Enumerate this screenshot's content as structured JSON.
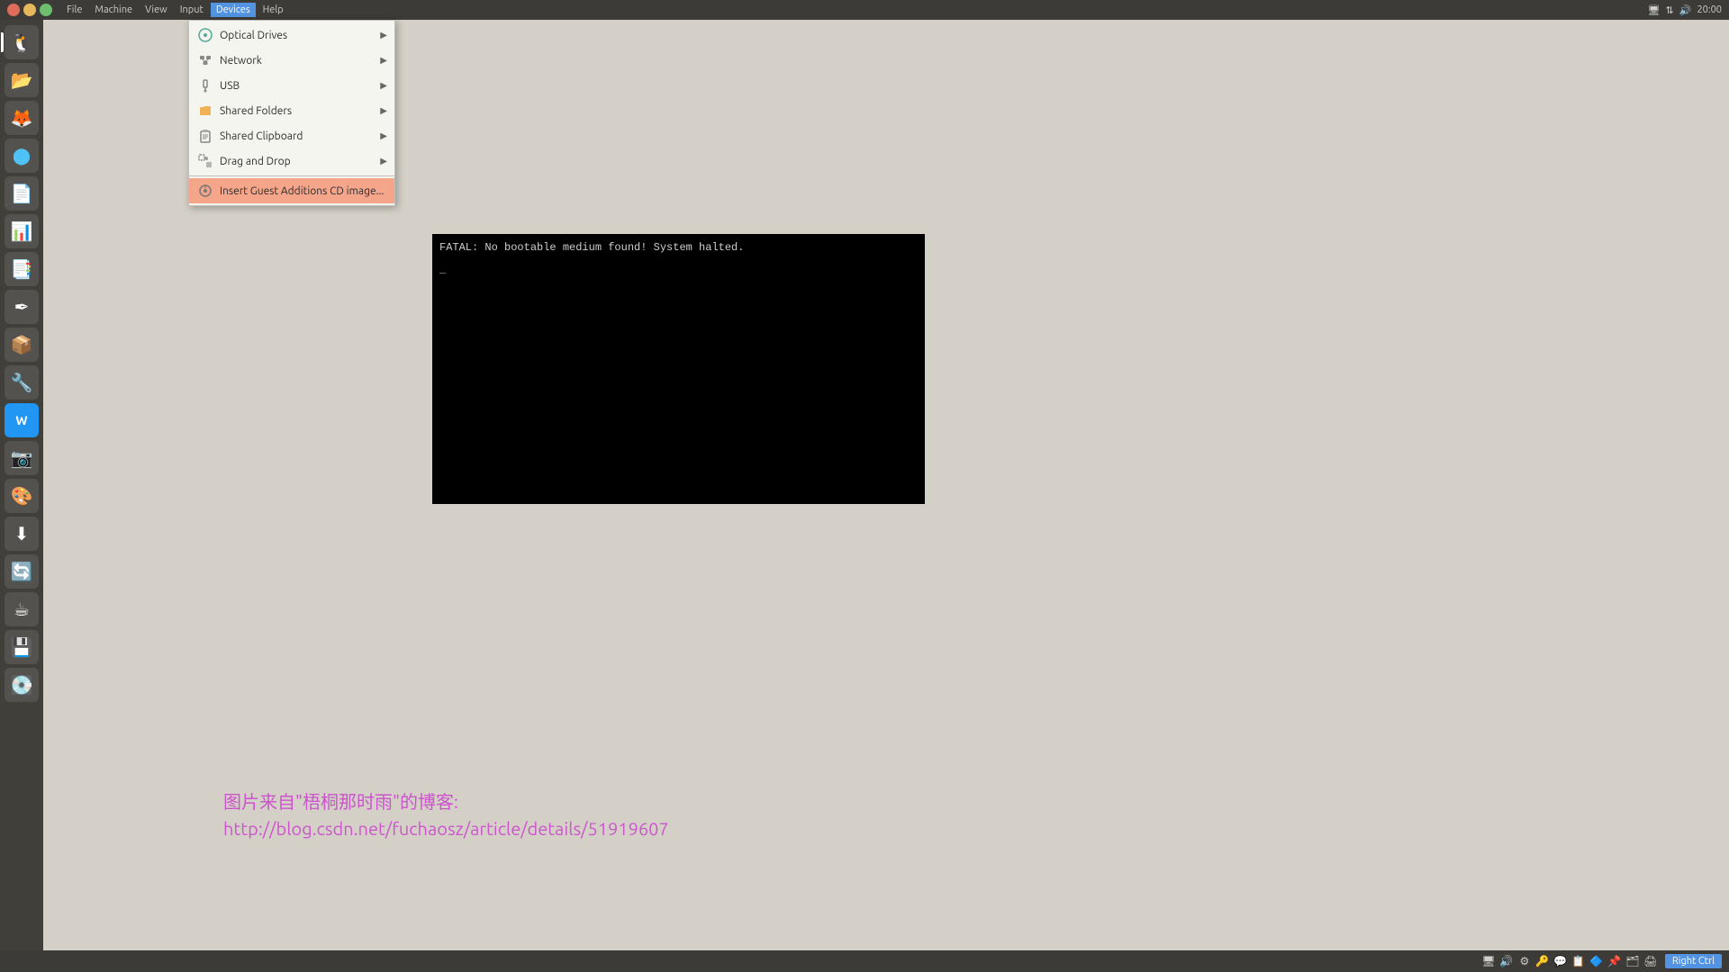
{
  "menubar": {
    "path": "|File|  Machine|  View|  Input|  Devices|",
    "path_items": [
      "File",
      "Machine",
      "View",
      "Input",
      "Devices",
      "Help"
    ],
    "active_item": "Devices",
    "time": "20:00",
    "win_title": "|File|  Machine|  View|  Input|  Devices|"
  },
  "dropdown": {
    "items": [
      {
        "id": "optical-drives",
        "label": "Optical Drives",
        "has_arrow": true,
        "icon": "💿"
      },
      {
        "id": "network",
        "label": "Network",
        "has_arrow": true,
        "icon": "🌐"
      },
      {
        "id": "usb",
        "label": "USB",
        "has_arrow": true,
        "icon": "🔌"
      },
      {
        "id": "shared-folders",
        "label": "Shared Folders",
        "has_arrow": true,
        "icon": "📁"
      },
      {
        "id": "shared-clipboard",
        "label": "Shared Clipboard",
        "has_arrow": true,
        "icon": "📋"
      },
      {
        "id": "drag-and-drop",
        "label": "Drag and Drop",
        "has_arrow": true,
        "icon": "🔀"
      },
      {
        "id": "insert-guest",
        "label": "Insert Guest Additions CD image...",
        "has_arrow": false,
        "icon": "💿",
        "highlighted": true
      }
    ]
  },
  "vm": {
    "screen_text": "FATAL: No bootable medium found! System halted.",
    "cursor": "_"
  },
  "attribution": {
    "line1": "图片来自\"梧桐那时雨\"的博客:",
    "line2": "http://blog.csdn.net/fuchaosz/article/details/51919607"
  },
  "taskbar": {
    "right_ctrl_label": "Right Ctrl",
    "time": "20:00"
  },
  "sidebar": {
    "apps": [
      {
        "id": "ubuntu",
        "icon": "🐧",
        "active": true
      },
      {
        "id": "files",
        "icon": "📂"
      },
      {
        "id": "firefox",
        "icon": "🦊"
      },
      {
        "id": "chrome",
        "icon": "⬤"
      },
      {
        "id": "text-editor",
        "icon": "📝"
      },
      {
        "id": "spreadsheet",
        "icon": "📊"
      },
      {
        "id": "presentation",
        "icon": "📑"
      },
      {
        "id": "typora",
        "icon": "✒"
      },
      {
        "id": "amazon",
        "icon": "📦"
      },
      {
        "id": "tools",
        "icon": "🔧"
      },
      {
        "id": "wavebox",
        "icon": "W"
      },
      {
        "id": "camera",
        "icon": "📸"
      },
      {
        "id": "drawing",
        "icon": "🎨"
      },
      {
        "id": "downloader",
        "icon": "⬇"
      },
      {
        "id": "vpn",
        "icon": "🔄"
      },
      {
        "id": "java-ide",
        "icon": "☕"
      },
      {
        "id": "disk",
        "icon": "💾"
      },
      {
        "id": "disk2",
        "icon": "💽"
      }
    ]
  }
}
